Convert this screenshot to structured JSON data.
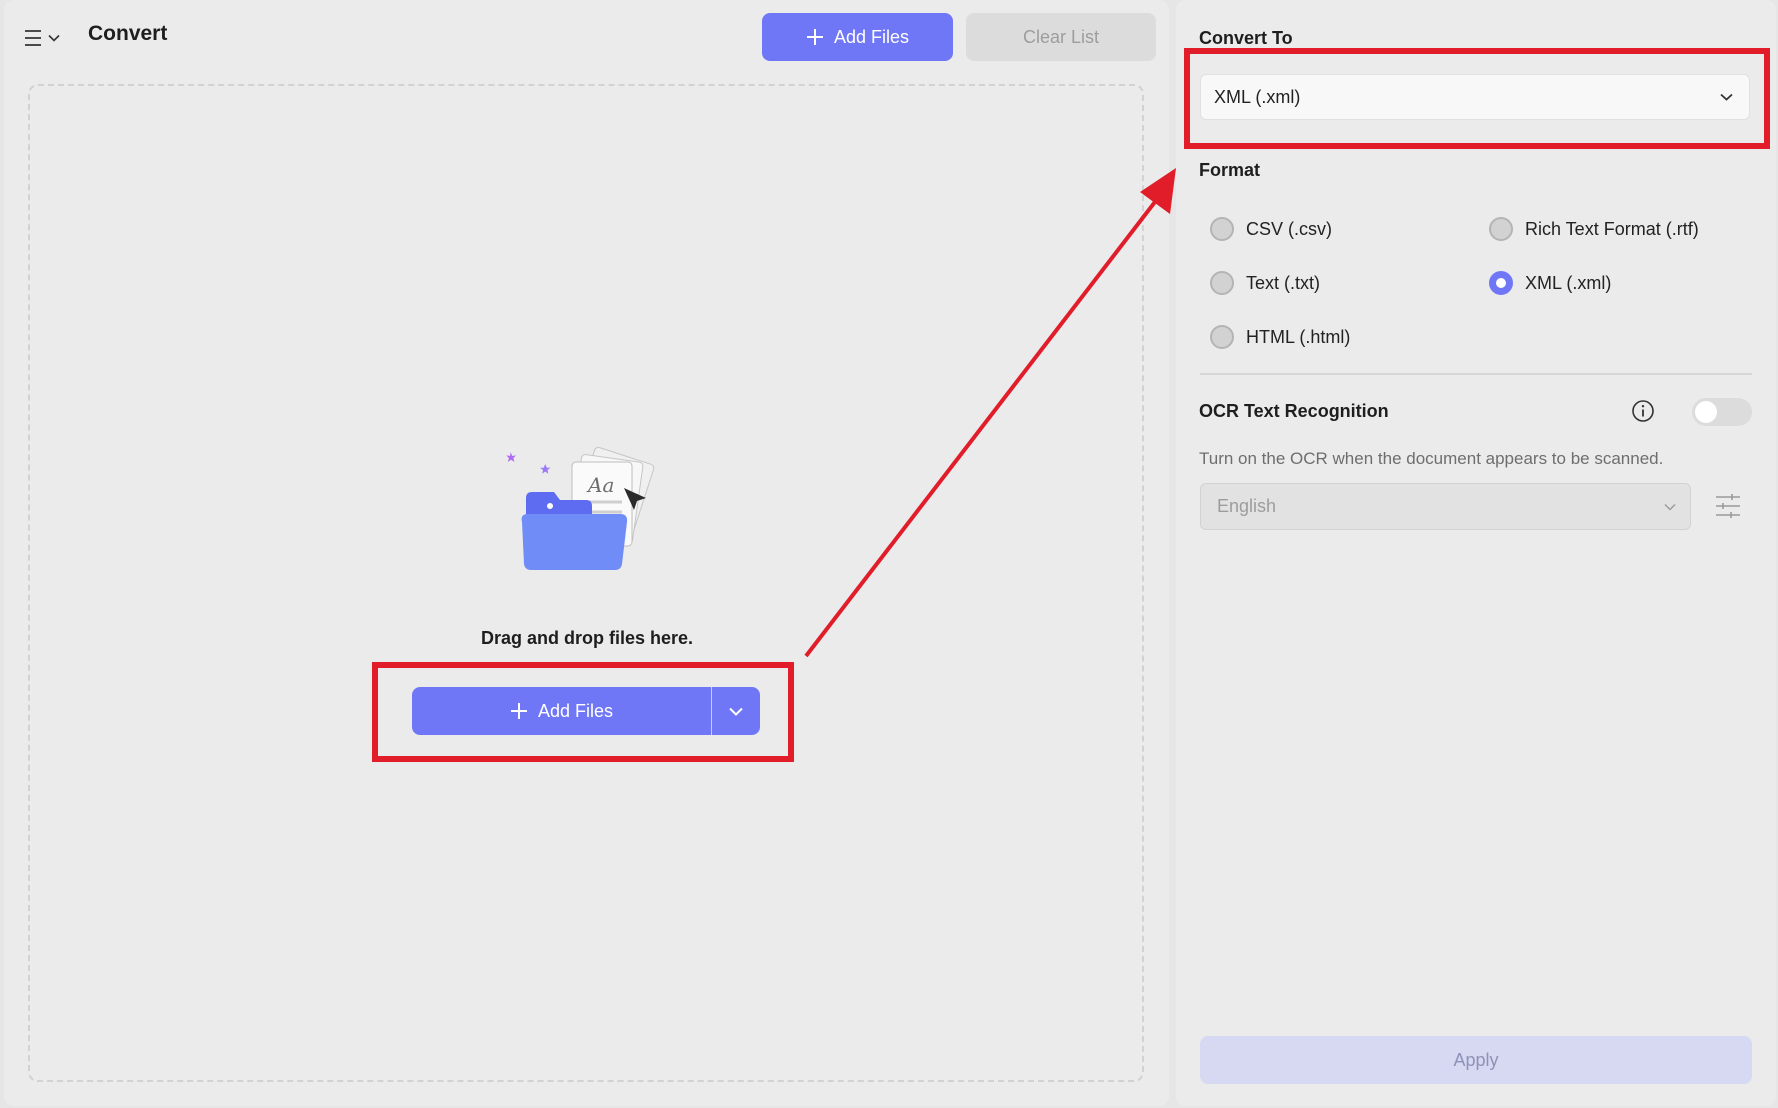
{
  "header": {
    "title": "Convert",
    "add_files_label": "Add Files",
    "clear_list_label": "Clear List"
  },
  "drop_zone": {
    "text": "Drag and drop files here.",
    "add_files_label": "Add Files"
  },
  "sidebar": {
    "convert_to_label": "Convert To",
    "convert_to_value": "XML (.xml)",
    "format_label": "Format",
    "formats": [
      {
        "label": "CSV (.csv)",
        "selected": false
      },
      {
        "label": "Rich Text Format (.rtf)",
        "selected": false
      },
      {
        "label": "Text (.txt)",
        "selected": false
      },
      {
        "label": "XML (.xml)",
        "selected": true
      },
      {
        "label": "HTML (.html)",
        "selected": false
      }
    ],
    "ocr_label": "OCR Text Recognition",
    "ocr_enabled": false,
    "ocr_hint": "Turn on the OCR when the document appears to be scanned.",
    "ocr_language": "English",
    "apply_label": "Apply"
  },
  "colors": {
    "accent": "#7077f7",
    "highlight": "#e11d2a"
  }
}
